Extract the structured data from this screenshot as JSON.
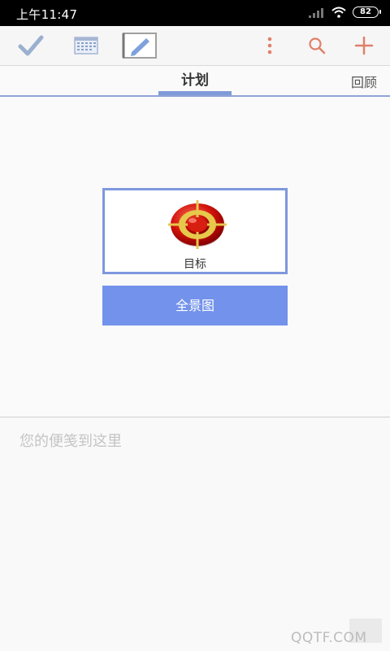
{
  "status_bar": {
    "time": "上午11:47",
    "battery": "82"
  },
  "toolbar": {
    "icons": [
      "check-icon",
      "calendar-icon",
      "edit-icon",
      "more-icon",
      "search-icon",
      "add-icon"
    ],
    "colors": {
      "muted": "#9bb0cf",
      "accent": "#e0806a",
      "active_box": "#a0a0a0"
    }
  },
  "tabs": {
    "active": "计划",
    "review": "回顾",
    "indicator_color": "#7f9ad8"
  },
  "goal_card": {
    "label": "目标",
    "icon": "target-icon"
  },
  "panorama_button": {
    "label": "全景图",
    "color": "#7292eb"
  },
  "note": {
    "placeholder": "您的便笺到这里"
  },
  "watermark": {
    "text": "QQTF.COM"
  }
}
